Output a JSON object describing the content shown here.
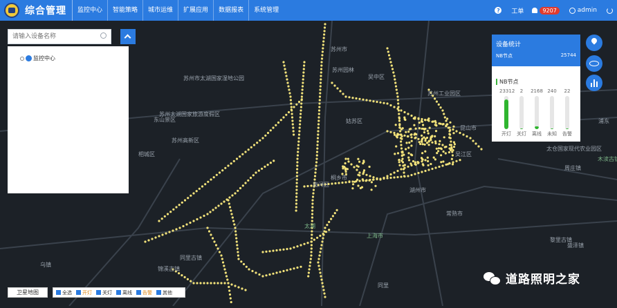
{
  "header": {
    "app_title": "综合管理",
    "nav": [
      "监控中心",
      "智能策略",
      "城市运维",
      "扩展应用",
      "数据报表",
      "系统管理"
    ],
    "ticket_label": "工单",
    "alarm_count": "9207",
    "username": "admin"
  },
  "search": {
    "placeholder": "请输入设备名称"
  },
  "tree": {
    "root_label": "监控中心"
  },
  "stats": {
    "title": "设备统计",
    "nb_label": "NB节点",
    "nb_total": "25744",
    "section_title": "NB节点",
    "columns": [
      {
        "label": "开灯",
        "value": "23312",
        "fill": 0.9
      },
      {
        "label": "关灯",
        "value": "2",
        "fill": 0.0
      },
      {
        "label": "离线",
        "value": "2168",
        "fill": 0.08
      },
      {
        "label": "未知",
        "value": "240",
        "fill": 0.02
      },
      {
        "label": "告警",
        "value": "22",
        "fill": 0.01
      }
    ]
  },
  "bottom": {
    "satellite_label": "卫星地图",
    "filters": [
      {
        "label": "全选",
        "color": "default"
      },
      {
        "label": "开灯",
        "color": "orange"
      },
      {
        "label": "关灯",
        "color": "default"
      },
      {
        "label": "离线",
        "color": "default"
      },
      {
        "label": "告警",
        "color": "orange"
      },
      {
        "label": "其他",
        "color": "default"
      }
    ]
  },
  "map_labels": [
    "苏州市",
    "苏州市太湖国家湿地公园",
    "苏州太湖国家旅游度假区",
    "东山景区",
    "苏州高新区",
    "相城区",
    "苏州园林",
    "吴中区",
    "姑苏区",
    "苏州工业园区",
    "昆山市",
    "浦东",
    "太仓国家现代农业园区",
    "吴江区",
    "南浔区",
    "桐乡市",
    "湖州市",
    "常熟市",
    "上海市",
    "太湖",
    "木渎古镇",
    "周庄镇",
    "同里古镇",
    "锦溪古镇",
    "乌镇",
    "同里",
    "黎里古镇",
    "盛泽镇"
  ],
  "watermark": {
    "text": "道路照明之家"
  },
  "colors": {
    "header_blue": "#2b7be0",
    "map_bg": "#1c2127",
    "lamp_yellow": "#f2e27a",
    "bar_green": "#2fb52f"
  }
}
